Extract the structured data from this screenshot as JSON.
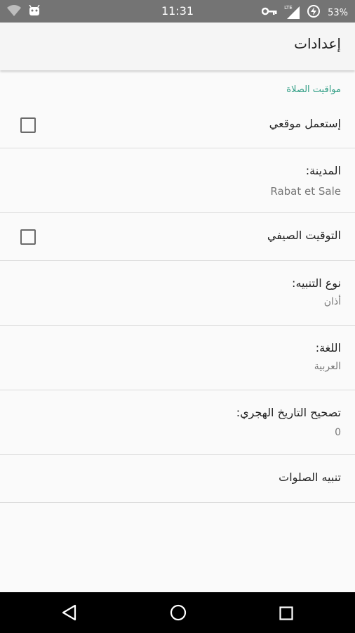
{
  "status_bar": {
    "time": "11:31",
    "battery": "53%",
    "network_label": "LTE"
  },
  "app_bar": {
    "title": "إعدادات"
  },
  "category": {
    "title": "مواقيت الصلاة"
  },
  "preferences": [
    {
      "title": "إستعمل موقعي",
      "type": "checkbox",
      "checked": false
    },
    {
      "title": "المدينة:",
      "summary": "Rabat et Sale"
    },
    {
      "title": "التوقيت الصيفي",
      "type": "checkbox",
      "checked": false
    },
    {
      "title": "نوع التنبيه:",
      "summary": "أذان"
    },
    {
      "title": "اللغة:",
      "summary": "العربية"
    },
    {
      "title": "تصحيح التاريخ الهجري:",
      "summary": "0"
    },
    {
      "title": "تنبيه الصلوات"
    }
  ],
  "colors": {
    "accent": "#2f9d84",
    "status_bar": "#747474",
    "nav_bar": "#000000"
  },
  "icons": [
    "wifi-icon",
    "android-debug-icon",
    "vpn-key-icon",
    "signal-icon",
    "battery-icon",
    "back-icon",
    "home-icon",
    "recents-icon"
  ]
}
